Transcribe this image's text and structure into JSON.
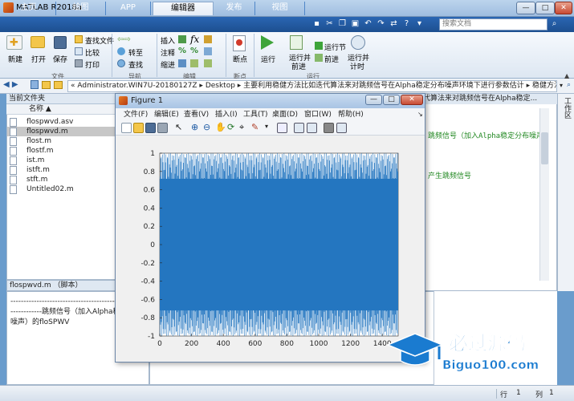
{
  "window": {
    "title": "MATLAB R2018a"
  },
  "tabs": [
    {
      "label": "主页"
    },
    {
      "label": "绘图"
    },
    {
      "label": "APP"
    },
    {
      "label": "编辑器"
    },
    {
      "label": "发布"
    },
    {
      "label": "视图"
    }
  ],
  "search": {
    "placeholder": "搜索文档"
  },
  "ribbon": {
    "file": {
      "new": "新建",
      "open": "打开",
      "save": "保存",
      "find_files": "查找文件",
      "compare": "比较",
      "print": "打印",
      "section": "文件"
    },
    "nav": {
      "goto": "转至",
      "find": "查找",
      "section": "导航"
    },
    "edit": {
      "insert": "插入",
      "comment": "注释",
      "indent": "缩进",
      "section": "编辑"
    },
    "breakpoints": {
      "label": "断点",
      "section": "断点"
    },
    "run": {
      "run": "运行",
      "run_advance_l1": "运行并",
      "run_advance_l2": "前进",
      "run_section": "运行节",
      "advance": "前进",
      "run_time_l1": "运行并",
      "run_time_l2": "计时",
      "section": "运行"
    }
  },
  "address": {
    "path": "« Administrator.WIN7U-20180127Z ▸ Desktop ▸ 主要利用稳健方法比如迭代算法来对跳频信号在Alpha稳定分布噪声环境下进行参数估计 ▸ 稳健方法"
  },
  "left": {
    "header": "当前文件夹",
    "col": "名称 ▲",
    "files": [
      "flospwvd.asv",
      "flospwvd.m",
      "flost.m",
      "flostf.m",
      "ist.m",
      "istft.m",
      "stft.m",
      "Untitled02.m"
    ],
    "detail_header": "flospwvd.m （脚本）",
    "detail_line1": "----------------------------------------------------",
    "detail_line2": "------------跳频信号（加入Alpha稳",
    "detail_line3": "噪声）的floSPWV"
  },
  "editor": {
    "tab": "代算法来对跳频信号在Alpha稳定...",
    "line1": "跳频信号（加入Alpha稳定分布噪声",
    "line2": "产生跳频信号"
  },
  "figure": {
    "title": "Figure 1",
    "menu": [
      "文件(F)",
      "编辑(E)",
      "查看(V)",
      "插入(I)",
      "工具(T)",
      "桌面(D)",
      "窗口(W)",
      "帮助(H)"
    ]
  },
  "right_strip": {
    "label": "工作区"
  },
  "status": {
    "row_label": "行",
    "row": "1",
    "col_label": "列",
    "col": "1"
  },
  "watermark": {
    "brand": "必过源码",
    "url": "Biguo100.com"
  },
  "chart_data": {
    "type": "line",
    "title": "",
    "xlabel": "",
    "ylabel": "",
    "xlim": [
      0,
      1500
    ],
    "ylim": [
      -1,
      1
    ],
    "xticks": [
      0,
      200,
      400,
      600,
      800,
      1000,
      1200,
      1400
    ],
    "yticks": [
      1,
      0.8,
      0.6,
      0.4,
      0.2,
      0,
      -0.2,
      -0.4,
      -0.6,
      -0.8,
      -1
    ],
    "series": [
      {
        "color": "#2476c0"
      }
    ]
  }
}
